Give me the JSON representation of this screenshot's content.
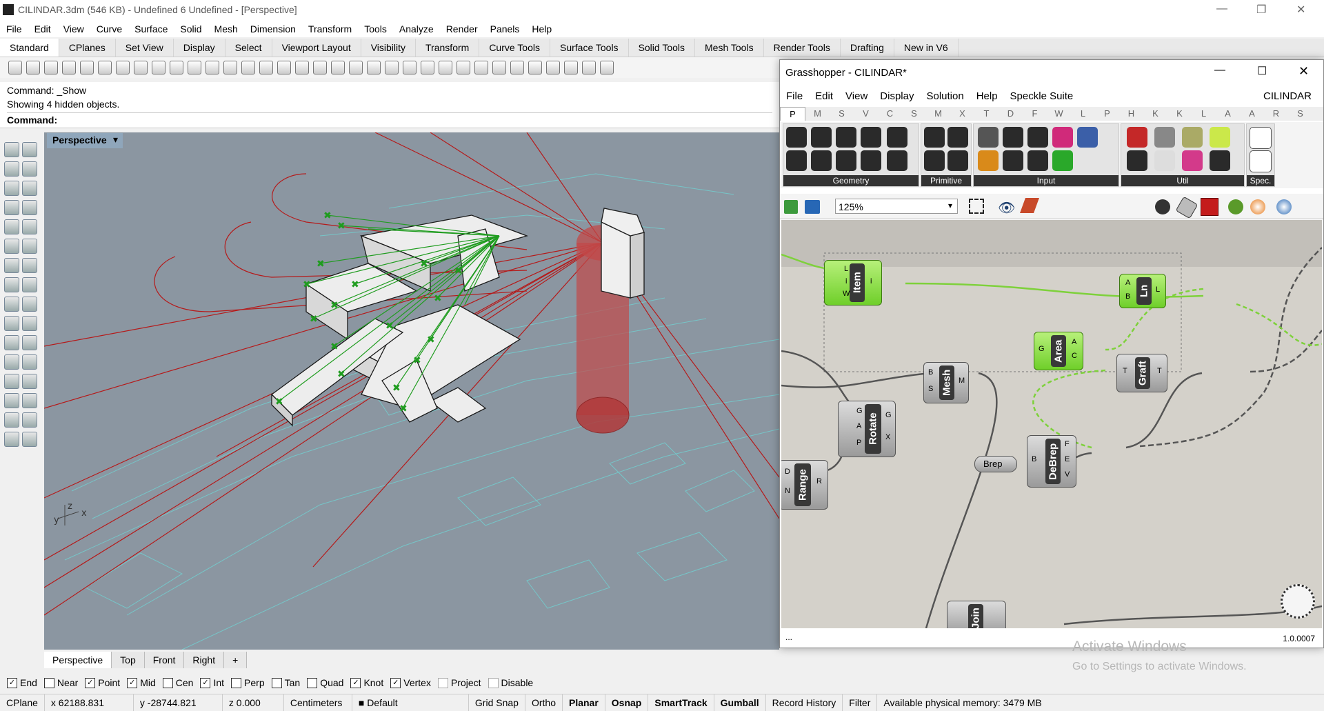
{
  "window": {
    "title": "CILINDAR.3dm (546 KB) - Undefined 6 Undefined - [Perspective]"
  },
  "menu": [
    "File",
    "Edit",
    "View",
    "Curve",
    "Surface",
    "Solid",
    "Mesh",
    "Dimension",
    "Transform",
    "Tools",
    "Analyze",
    "Render",
    "Panels",
    "Help"
  ],
  "tabs": [
    "Standard",
    "CPlanes",
    "Set View",
    "Display",
    "Select",
    "Viewport Layout",
    "Visibility",
    "Transform",
    "Curve Tools",
    "Surface Tools",
    "Solid Tools",
    "Mesh Tools",
    "Render Tools",
    "Drafting",
    "New in V6"
  ],
  "command": {
    "line1": "Command: _Show",
    "line2": "Showing 4 hidden objects.",
    "prompt": "Command:"
  },
  "viewport": {
    "name": "Perspective"
  },
  "viewport_tabs": [
    "Perspective",
    "Top",
    "Front",
    "Right"
  ],
  "osnap": [
    {
      "label": "End",
      "checked": true
    },
    {
      "label": "Near",
      "checked": false
    },
    {
      "label": "Point",
      "checked": true
    },
    {
      "label": "Mid",
      "checked": true
    },
    {
      "label": "Cen",
      "checked": false
    },
    {
      "label": "Int",
      "checked": true
    },
    {
      "label": "Perp",
      "checked": false
    },
    {
      "label": "Tan",
      "checked": false
    },
    {
      "label": "Quad",
      "checked": false
    },
    {
      "label": "Knot",
      "checked": true
    },
    {
      "label": "Vertex",
      "checked": true
    },
    {
      "label": "Project",
      "checked": false
    },
    {
      "label": "Disable",
      "checked": false
    }
  ],
  "status": {
    "cplane": "CPlane",
    "x": "x 62188.831",
    "y": "y -28744.821",
    "z": "z 0.000",
    "units": "Centimeters",
    "layer": "Default",
    "gridsnap": "Grid Snap",
    "ortho": "Ortho",
    "planar": "Planar",
    "osnap": "Osnap",
    "smarttrack": "SmartTrack",
    "gumball": "Gumball",
    "history": "Record History",
    "filter": "Filter",
    "memory": "Available physical memory: 3479 MB"
  },
  "gh": {
    "title": "Grasshopper - CILINDAR*",
    "menu": [
      "File",
      "Edit",
      "View",
      "Display",
      "Solution",
      "Help",
      "Speckle Suite"
    ],
    "doc": "CILINDAR",
    "cats": [
      "P",
      "M",
      "S",
      "V",
      "C",
      "S",
      "M",
      "X",
      "T",
      "D",
      "F",
      "W",
      "L",
      "P",
      "H",
      "K",
      "K",
      "L",
      "A",
      "A",
      "R",
      "S"
    ],
    "groups": [
      "Geometry",
      "Primitive",
      "Input",
      "Util",
      "Spec."
    ],
    "zoom": "125%",
    "version": "1.0.0007",
    "statusleft": "...",
    "components": {
      "item": "Item",
      "ln": "Ln",
      "area": "Area",
      "mesh": "Mesh",
      "rotate": "Rotate",
      "graft": "Graft",
      "debrep": "DeBrep",
      "range": "Range",
      "brep": "Brep",
      "join": "Join"
    }
  },
  "watermark": {
    "line1": "Activate Windows",
    "line2": "Go to Settings to activate Windows."
  }
}
